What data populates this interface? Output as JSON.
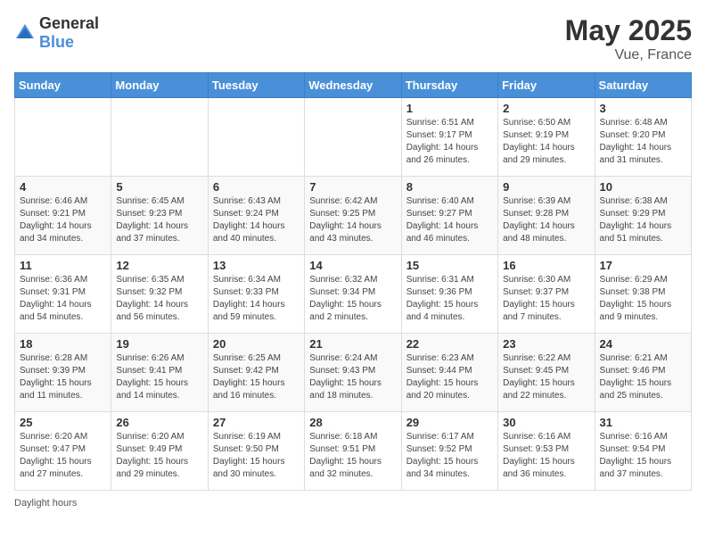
{
  "header": {
    "logo_general": "General",
    "logo_blue": "Blue",
    "month_title": "May 2025",
    "location": "Vue, France"
  },
  "weekdays": [
    "Sunday",
    "Monday",
    "Tuesday",
    "Wednesday",
    "Thursday",
    "Friday",
    "Saturday"
  ],
  "footer": {
    "daylight_note": "Daylight hours"
  },
  "weeks": [
    [
      {
        "day": "",
        "sunrise": "",
        "sunset": "",
        "daylight": ""
      },
      {
        "day": "",
        "sunrise": "",
        "sunset": "",
        "daylight": ""
      },
      {
        "day": "",
        "sunrise": "",
        "sunset": "",
        "daylight": ""
      },
      {
        "day": "",
        "sunrise": "",
        "sunset": "",
        "daylight": ""
      },
      {
        "day": "1",
        "sunrise": "Sunrise: 6:51 AM",
        "sunset": "Sunset: 9:17 PM",
        "daylight": "Daylight: 14 hours and 26 minutes."
      },
      {
        "day": "2",
        "sunrise": "Sunrise: 6:50 AM",
        "sunset": "Sunset: 9:19 PM",
        "daylight": "Daylight: 14 hours and 29 minutes."
      },
      {
        "day": "3",
        "sunrise": "Sunrise: 6:48 AM",
        "sunset": "Sunset: 9:20 PM",
        "daylight": "Daylight: 14 hours and 31 minutes."
      }
    ],
    [
      {
        "day": "4",
        "sunrise": "Sunrise: 6:46 AM",
        "sunset": "Sunset: 9:21 PM",
        "daylight": "Daylight: 14 hours and 34 minutes."
      },
      {
        "day": "5",
        "sunrise": "Sunrise: 6:45 AM",
        "sunset": "Sunset: 9:23 PM",
        "daylight": "Daylight: 14 hours and 37 minutes."
      },
      {
        "day": "6",
        "sunrise": "Sunrise: 6:43 AM",
        "sunset": "Sunset: 9:24 PM",
        "daylight": "Daylight: 14 hours and 40 minutes."
      },
      {
        "day": "7",
        "sunrise": "Sunrise: 6:42 AM",
        "sunset": "Sunset: 9:25 PM",
        "daylight": "Daylight: 14 hours and 43 minutes."
      },
      {
        "day": "8",
        "sunrise": "Sunrise: 6:40 AM",
        "sunset": "Sunset: 9:27 PM",
        "daylight": "Daylight: 14 hours and 46 minutes."
      },
      {
        "day": "9",
        "sunrise": "Sunrise: 6:39 AM",
        "sunset": "Sunset: 9:28 PM",
        "daylight": "Daylight: 14 hours and 48 minutes."
      },
      {
        "day": "10",
        "sunrise": "Sunrise: 6:38 AM",
        "sunset": "Sunset: 9:29 PM",
        "daylight": "Daylight: 14 hours and 51 minutes."
      }
    ],
    [
      {
        "day": "11",
        "sunrise": "Sunrise: 6:36 AM",
        "sunset": "Sunset: 9:31 PM",
        "daylight": "Daylight: 14 hours and 54 minutes."
      },
      {
        "day": "12",
        "sunrise": "Sunrise: 6:35 AM",
        "sunset": "Sunset: 9:32 PM",
        "daylight": "Daylight: 14 hours and 56 minutes."
      },
      {
        "day": "13",
        "sunrise": "Sunrise: 6:34 AM",
        "sunset": "Sunset: 9:33 PM",
        "daylight": "Daylight: 14 hours and 59 minutes."
      },
      {
        "day": "14",
        "sunrise": "Sunrise: 6:32 AM",
        "sunset": "Sunset: 9:34 PM",
        "daylight": "Daylight: 15 hours and 2 minutes."
      },
      {
        "day": "15",
        "sunrise": "Sunrise: 6:31 AM",
        "sunset": "Sunset: 9:36 PM",
        "daylight": "Daylight: 15 hours and 4 minutes."
      },
      {
        "day": "16",
        "sunrise": "Sunrise: 6:30 AM",
        "sunset": "Sunset: 9:37 PM",
        "daylight": "Daylight: 15 hours and 7 minutes."
      },
      {
        "day": "17",
        "sunrise": "Sunrise: 6:29 AM",
        "sunset": "Sunset: 9:38 PM",
        "daylight": "Daylight: 15 hours and 9 minutes."
      }
    ],
    [
      {
        "day": "18",
        "sunrise": "Sunrise: 6:28 AM",
        "sunset": "Sunset: 9:39 PM",
        "daylight": "Daylight: 15 hours and 11 minutes."
      },
      {
        "day": "19",
        "sunrise": "Sunrise: 6:26 AM",
        "sunset": "Sunset: 9:41 PM",
        "daylight": "Daylight: 15 hours and 14 minutes."
      },
      {
        "day": "20",
        "sunrise": "Sunrise: 6:25 AM",
        "sunset": "Sunset: 9:42 PM",
        "daylight": "Daylight: 15 hours and 16 minutes."
      },
      {
        "day": "21",
        "sunrise": "Sunrise: 6:24 AM",
        "sunset": "Sunset: 9:43 PM",
        "daylight": "Daylight: 15 hours and 18 minutes."
      },
      {
        "day": "22",
        "sunrise": "Sunrise: 6:23 AM",
        "sunset": "Sunset: 9:44 PM",
        "daylight": "Daylight: 15 hours and 20 minutes."
      },
      {
        "day": "23",
        "sunrise": "Sunrise: 6:22 AM",
        "sunset": "Sunset: 9:45 PM",
        "daylight": "Daylight: 15 hours and 22 minutes."
      },
      {
        "day": "24",
        "sunrise": "Sunrise: 6:21 AM",
        "sunset": "Sunset: 9:46 PM",
        "daylight": "Daylight: 15 hours and 25 minutes."
      }
    ],
    [
      {
        "day": "25",
        "sunrise": "Sunrise: 6:20 AM",
        "sunset": "Sunset: 9:47 PM",
        "daylight": "Daylight: 15 hours and 27 minutes."
      },
      {
        "day": "26",
        "sunrise": "Sunrise: 6:20 AM",
        "sunset": "Sunset: 9:49 PM",
        "daylight": "Daylight: 15 hours and 29 minutes."
      },
      {
        "day": "27",
        "sunrise": "Sunrise: 6:19 AM",
        "sunset": "Sunset: 9:50 PM",
        "daylight": "Daylight: 15 hours and 30 minutes."
      },
      {
        "day": "28",
        "sunrise": "Sunrise: 6:18 AM",
        "sunset": "Sunset: 9:51 PM",
        "daylight": "Daylight: 15 hours and 32 minutes."
      },
      {
        "day": "29",
        "sunrise": "Sunrise: 6:17 AM",
        "sunset": "Sunset: 9:52 PM",
        "daylight": "Daylight: 15 hours and 34 minutes."
      },
      {
        "day": "30",
        "sunrise": "Sunrise: 6:16 AM",
        "sunset": "Sunset: 9:53 PM",
        "daylight": "Daylight: 15 hours and 36 minutes."
      },
      {
        "day": "31",
        "sunrise": "Sunrise: 6:16 AM",
        "sunset": "Sunset: 9:54 PM",
        "daylight": "Daylight: 15 hours and 37 minutes."
      }
    ]
  ]
}
